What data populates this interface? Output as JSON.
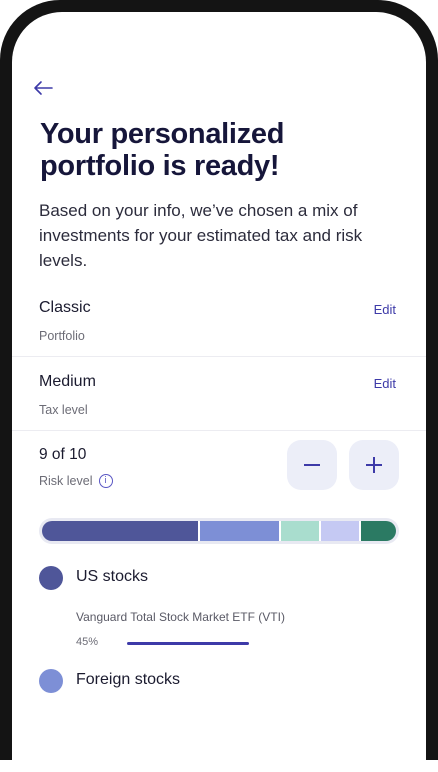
{
  "header": {
    "title": "Your personalized portfolio is ready!",
    "subtitle": "Based on your info, we’ve chosen a mix of investments for your estimated tax and risk levels."
  },
  "settings": [
    {
      "label": "Classic",
      "sub": "Portfolio",
      "action": "Edit"
    },
    {
      "label": "Medium",
      "sub": "Tax level",
      "action": "Edit"
    }
  ],
  "risk": {
    "value": "9 of 10",
    "label": "Risk level",
    "level": 9,
    "max": 10
  },
  "mix": {
    "segments": [
      {
        "name": "US stocks",
        "fraction": 0.45,
        "color": "#4f5699"
      },
      {
        "name": "Foreign stocks",
        "fraction": 0.23,
        "color": "#7d8fd6"
      },
      {
        "name": "segment-3",
        "fraction": 0.11,
        "color": "#a9ddce"
      },
      {
        "name": "segment-4",
        "fraction": 0.11,
        "color": "#c5c9f3"
      },
      {
        "name": "segment-5",
        "fraction": 0.1,
        "color": "#2b7a63"
      }
    ]
  },
  "assets": [
    {
      "name": "US stocks",
      "fund": "Vanguard Total Stock Market ETF (VTI)",
      "percent": "45%",
      "fraction": 0.45,
      "color": "#4f5699",
      "bar_color": "#3d3aa8"
    },
    {
      "name": "Foreign stocks",
      "fund": "",
      "percent": "",
      "fraction": 0.23,
      "color": "#7d8fd6",
      "bar_color": "#7d8fd6"
    }
  ],
  "icons": {
    "back": "arrow-left-icon",
    "info": "info-icon",
    "minus": "minus-icon",
    "plus": "plus-icon"
  },
  "colors": {
    "accent": "#3d3aa8",
    "title": "#16163a",
    "button_bg": "#eceef8"
  }
}
